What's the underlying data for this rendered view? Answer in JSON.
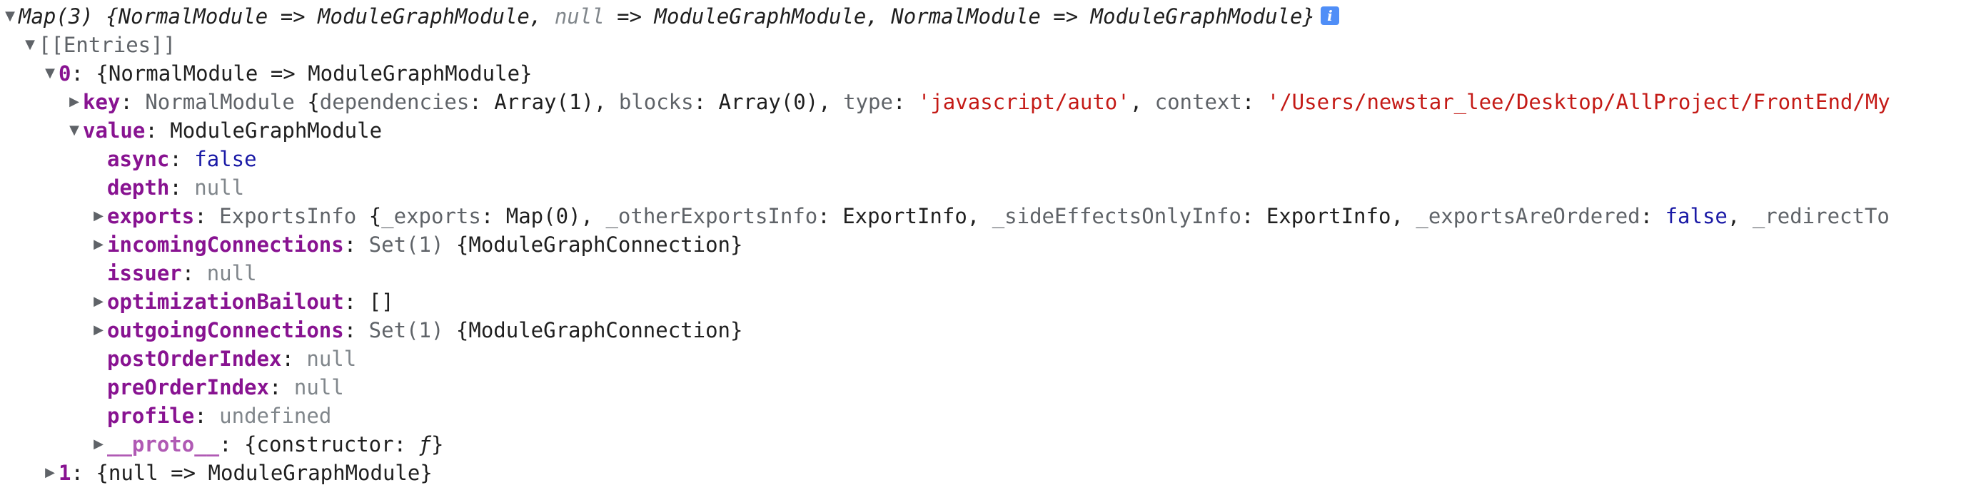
{
  "root": {
    "type_label": "Map(3)",
    "preview_open": "{",
    "preview_k1": "NormalModule",
    "arrow": "=>",
    "preview_v1": "ModuleGraphModule",
    "comma": ",",
    "preview_k2": "null",
    "preview_v2": "ModuleGraphModule",
    "preview_k3": "NormalModule",
    "preview_v3": "ModuleGraphModule",
    "preview_close": "}",
    "info_icon": "info-icon"
  },
  "entries": {
    "label": "[[Entries]]"
  },
  "entry0": {
    "index": "0",
    "colon": ":",
    "preview": "{NormalModule => ModuleGraphModule}"
  },
  "key_row": {
    "name": "key",
    "class_name": "NormalModule",
    "p_open": "{",
    "f1": "dependencies",
    "v1": "Array(1)",
    "f2": "blocks",
    "v2": "Array(0)",
    "f3": "type",
    "v3": "'javascript/auto'",
    "f4": "context",
    "v4": "'/Users/newstar_lee/Desktop/AllProject/FrontEnd/My"
  },
  "value_row": {
    "name": "value",
    "class_name": "ModuleGraphModule"
  },
  "props": {
    "async": {
      "name": "async",
      "value": "false"
    },
    "depth": {
      "name": "depth",
      "value": "null"
    },
    "exports": {
      "name": "exports",
      "class_name": "ExportsInfo",
      "p_open": "{",
      "f1": "_exports",
      "v1": "Map(0)",
      "f2": "_otherExportsInfo",
      "v2": "ExportInfo",
      "f3": "_sideEffectsOnlyInfo",
      "v3": "ExportInfo",
      "f4": "_exportsAreOrdered",
      "v4": "false",
      "f5": "_redirectTo"
    },
    "incoming": {
      "name": "incomingConnections",
      "type_label": "Set(1)",
      "preview": "{ModuleGraphConnection}"
    },
    "issuer": {
      "name": "issuer",
      "value": "null"
    },
    "bailout": {
      "name": "optimizationBailout",
      "value": "[]"
    },
    "outgoing": {
      "name": "outgoingConnections",
      "type_label": "Set(1)",
      "preview": "{ModuleGraphConnection}"
    },
    "post": {
      "name": "postOrderIndex",
      "value": "null"
    },
    "pre": {
      "name": "preOrderIndex",
      "value": "null"
    },
    "profile": {
      "name": "profile",
      "value": "undefined"
    },
    "proto": {
      "name": "__proto__",
      "p_open": "{",
      "f1": "constructor",
      "v1": "ƒ",
      "p_close": "}"
    }
  },
  "entry1": {
    "index": "1",
    "colon": ":",
    "preview": "{null => ModuleGraphModule}"
  },
  "colors": {
    "key": "#881391",
    "string": "#c41a16",
    "boolean": "#1a1aa6",
    "null": "#80868b",
    "info_icon_bg": "#4f8ef7"
  }
}
